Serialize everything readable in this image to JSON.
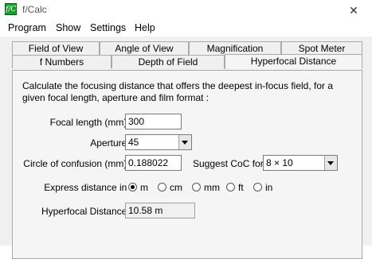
{
  "window": {
    "icon_text": "f/C",
    "title": "f/Calc",
    "close_glyph": "✕"
  },
  "menu": [
    "Program",
    "Show",
    "Settings",
    "Help"
  ],
  "tabs_top": [
    "Field of View",
    "Angle of View",
    "Magnification",
    "Spot Meter"
  ],
  "tabs_bottom": [
    "f Numbers",
    "Depth of Field",
    "Hyperfocal Distance"
  ],
  "active_tab": "Hyperfocal Distance",
  "panel": {
    "description": "Calculate the focusing distance that offers the deepest in-focus field, for a given focal length, aperture and film format :",
    "focal_length": {
      "label": "Focal length (mm) :",
      "value": "300"
    },
    "aperture": {
      "label": "Aperture :",
      "value": "45"
    },
    "coc": {
      "label": "Circle of confusion (mm) :",
      "value": "0.188022"
    },
    "suggest": {
      "label": "Suggest CoC for :",
      "value": "8 × 10"
    },
    "units": {
      "label": "Express distance in :",
      "options": [
        "m",
        "cm",
        "mm",
        "ft",
        "in"
      ],
      "selected": "m"
    },
    "hyperfocal": {
      "label": "Hyperfocal Distance :",
      "value": "10.58 m"
    }
  }
}
